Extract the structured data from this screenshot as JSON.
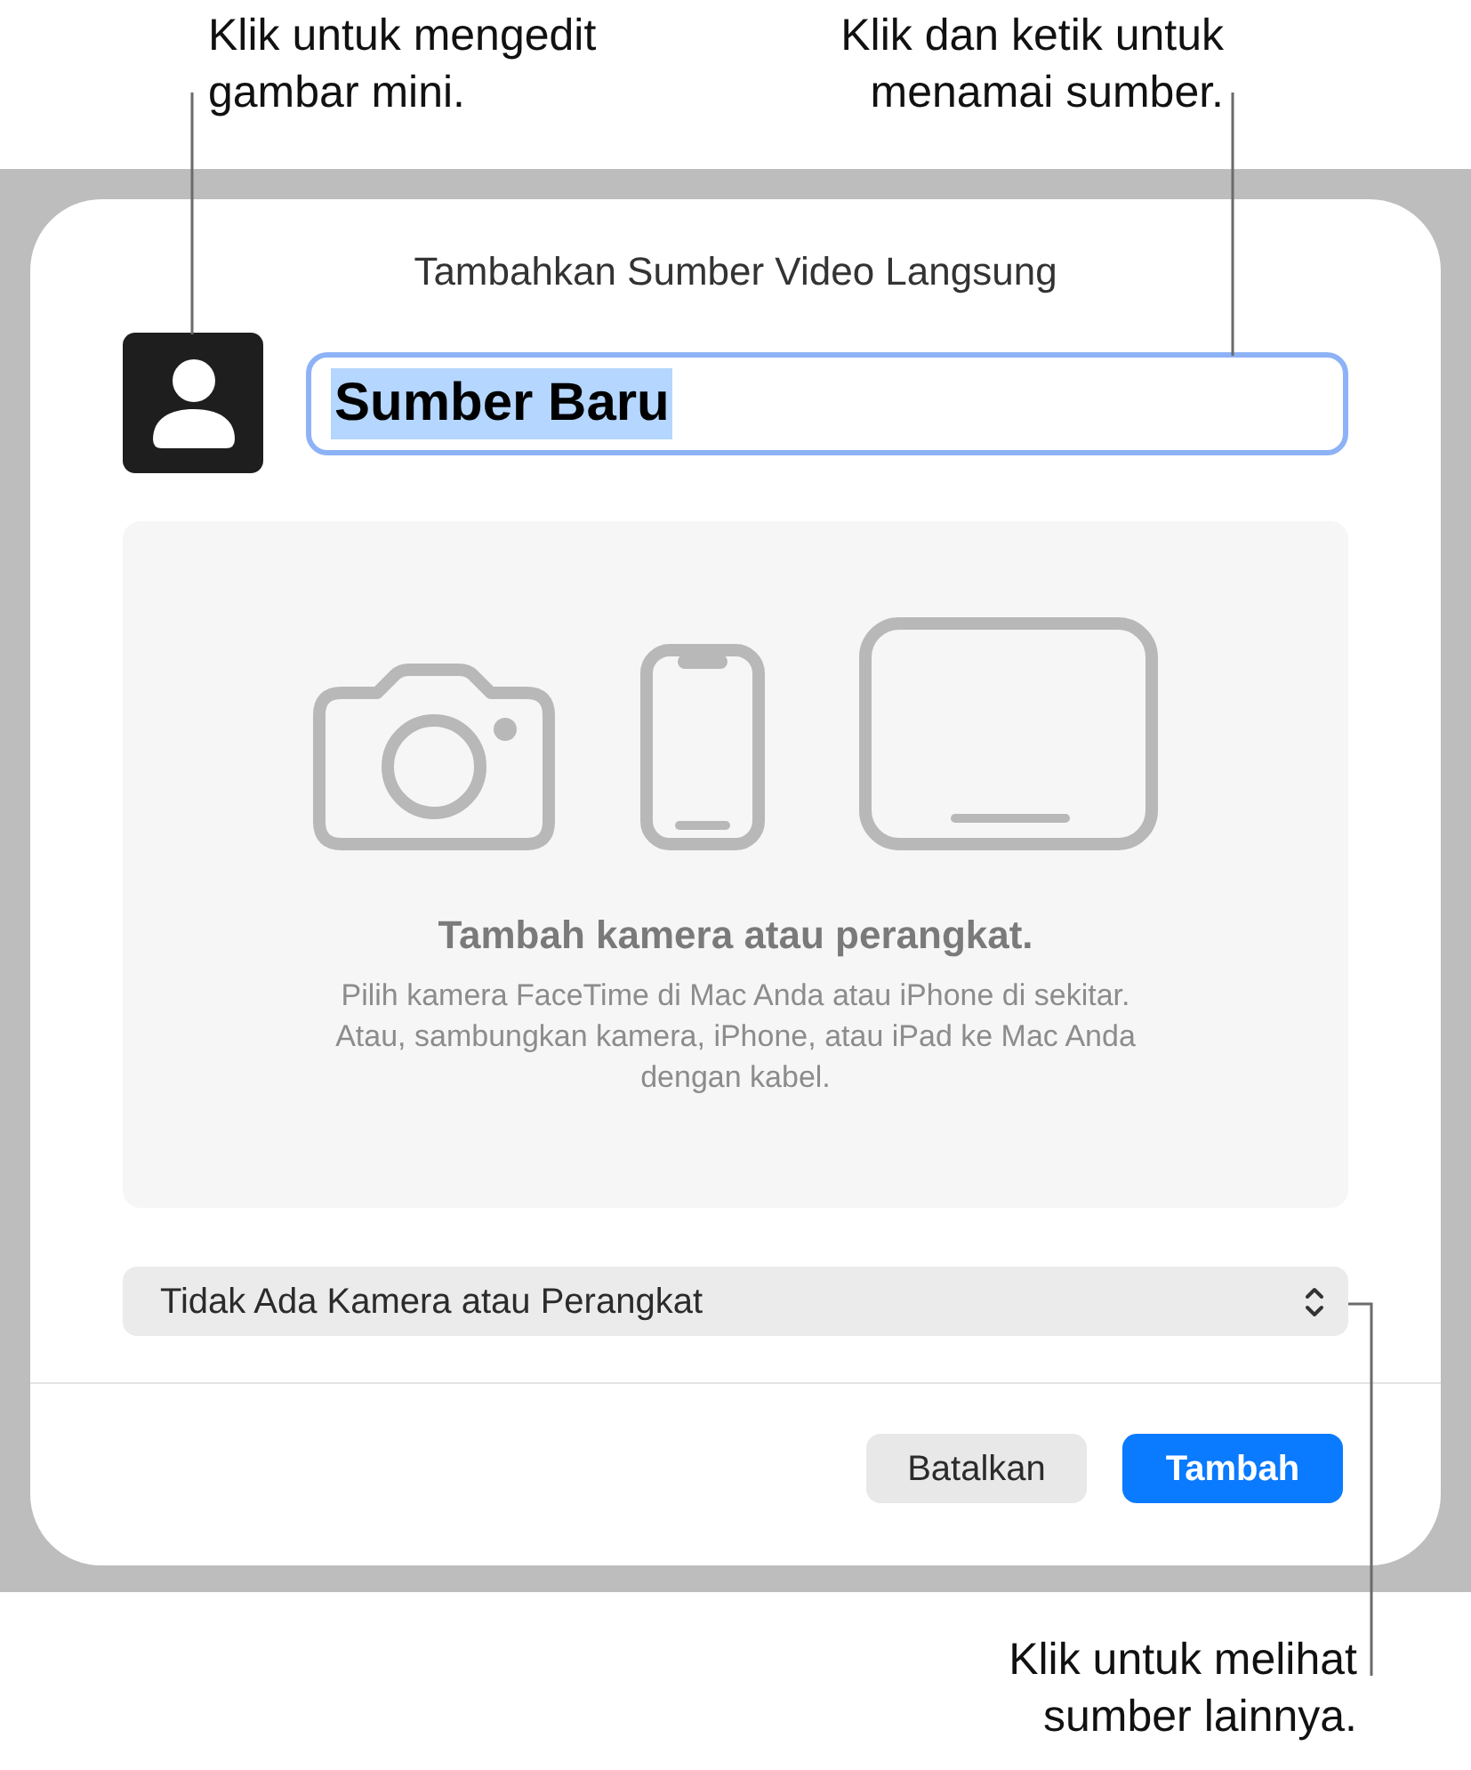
{
  "callouts": {
    "thumbnail": "Klik untuk mengedit gambar mini.",
    "name_field": "Klik dan ketik untuk menamai sumber.",
    "source_menu": "Klik untuk melihat sumber lainnya."
  },
  "dialog": {
    "title": "Tambahkan Sumber Video Langsung",
    "name_field": {
      "value": "Sumber Baru",
      "focused": true,
      "text_selected": true
    },
    "preview": {
      "heading": "Tambah kamera atau perangkat.",
      "body": "Pilih kamera FaceTime di Mac Anda atau iPhone di sekitar. Atau, sambungkan kamera, iPhone, atau iPad ke Mac Anda dengan kabel."
    },
    "source_menu": {
      "value": "Tidak Ada Kamera atau Perangkat"
    },
    "buttons": [
      {
        "label": "Batalkan",
        "kind": "secondary"
      },
      {
        "label": "Tambah",
        "kind": "primary"
      }
    ]
  }
}
